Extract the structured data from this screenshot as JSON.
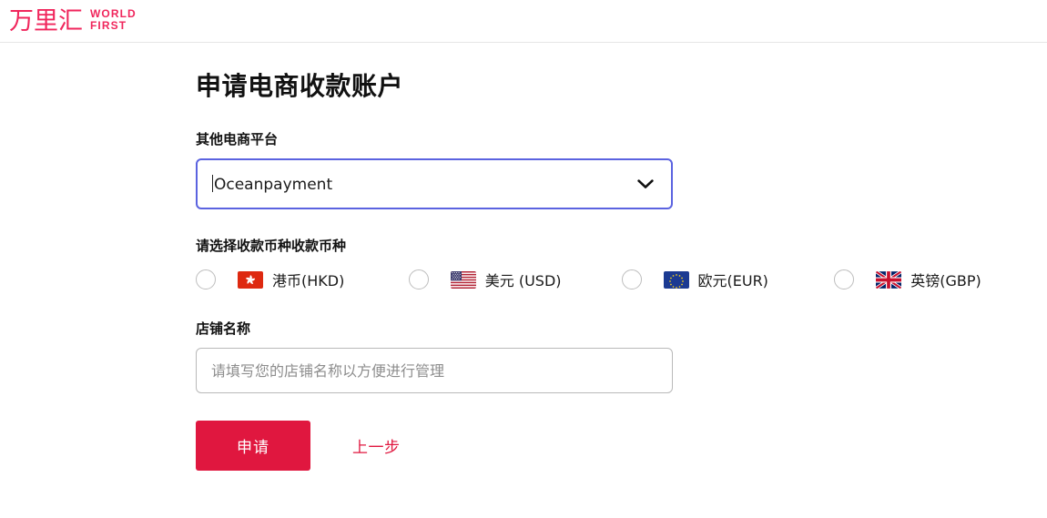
{
  "header": {
    "logo_cn": "万里汇",
    "logo_en_line1": "WORLD",
    "logo_en_line2": "FIRST",
    "logo_color": "#f0265c"
  },
  "page": {
    "title": "申请电商收款账户"
  },
  "platform_field": {
    "label": "其他电商平台",
    "selected_value": "Oceanpayment",
    "chevron_icon": "chevron-down-icon",
    "focus_border_color": "#5b63e0"
  },
  "currency_field": {
    "label": "请选择收款币种收款币种",
    "options": [
      {
        "label": "港币(HKD)",
        "code": "HKD",
        "flag": "hk-flag-icon",
        "selected": false
      },
      {
        "label": "美元 (USD)",
        "code": "USD",
        "flag": "us-flag-icon",
        "selected": false
      },
      {
        "label": "欧元(EUR)",
        "code": "EUR",
        "flag": "eu-flag-icon",
        "selected": false
      },
      {
        "label": "英镑(GBP)",
        "code": "GBP",
        "flag": "gb-flag-icon",
        "selected": false
      }
    ]
  },
  "store_field": {
    "label": "店铺名称",
    "value": "",
    "placeholder": "请填写您的店铺名称以方便进行管理"
  },
  "actions": {
    "submit_label": "申请",
    "back_label": "上一步",
    "accent_color": "#e0173f"
  }
}
